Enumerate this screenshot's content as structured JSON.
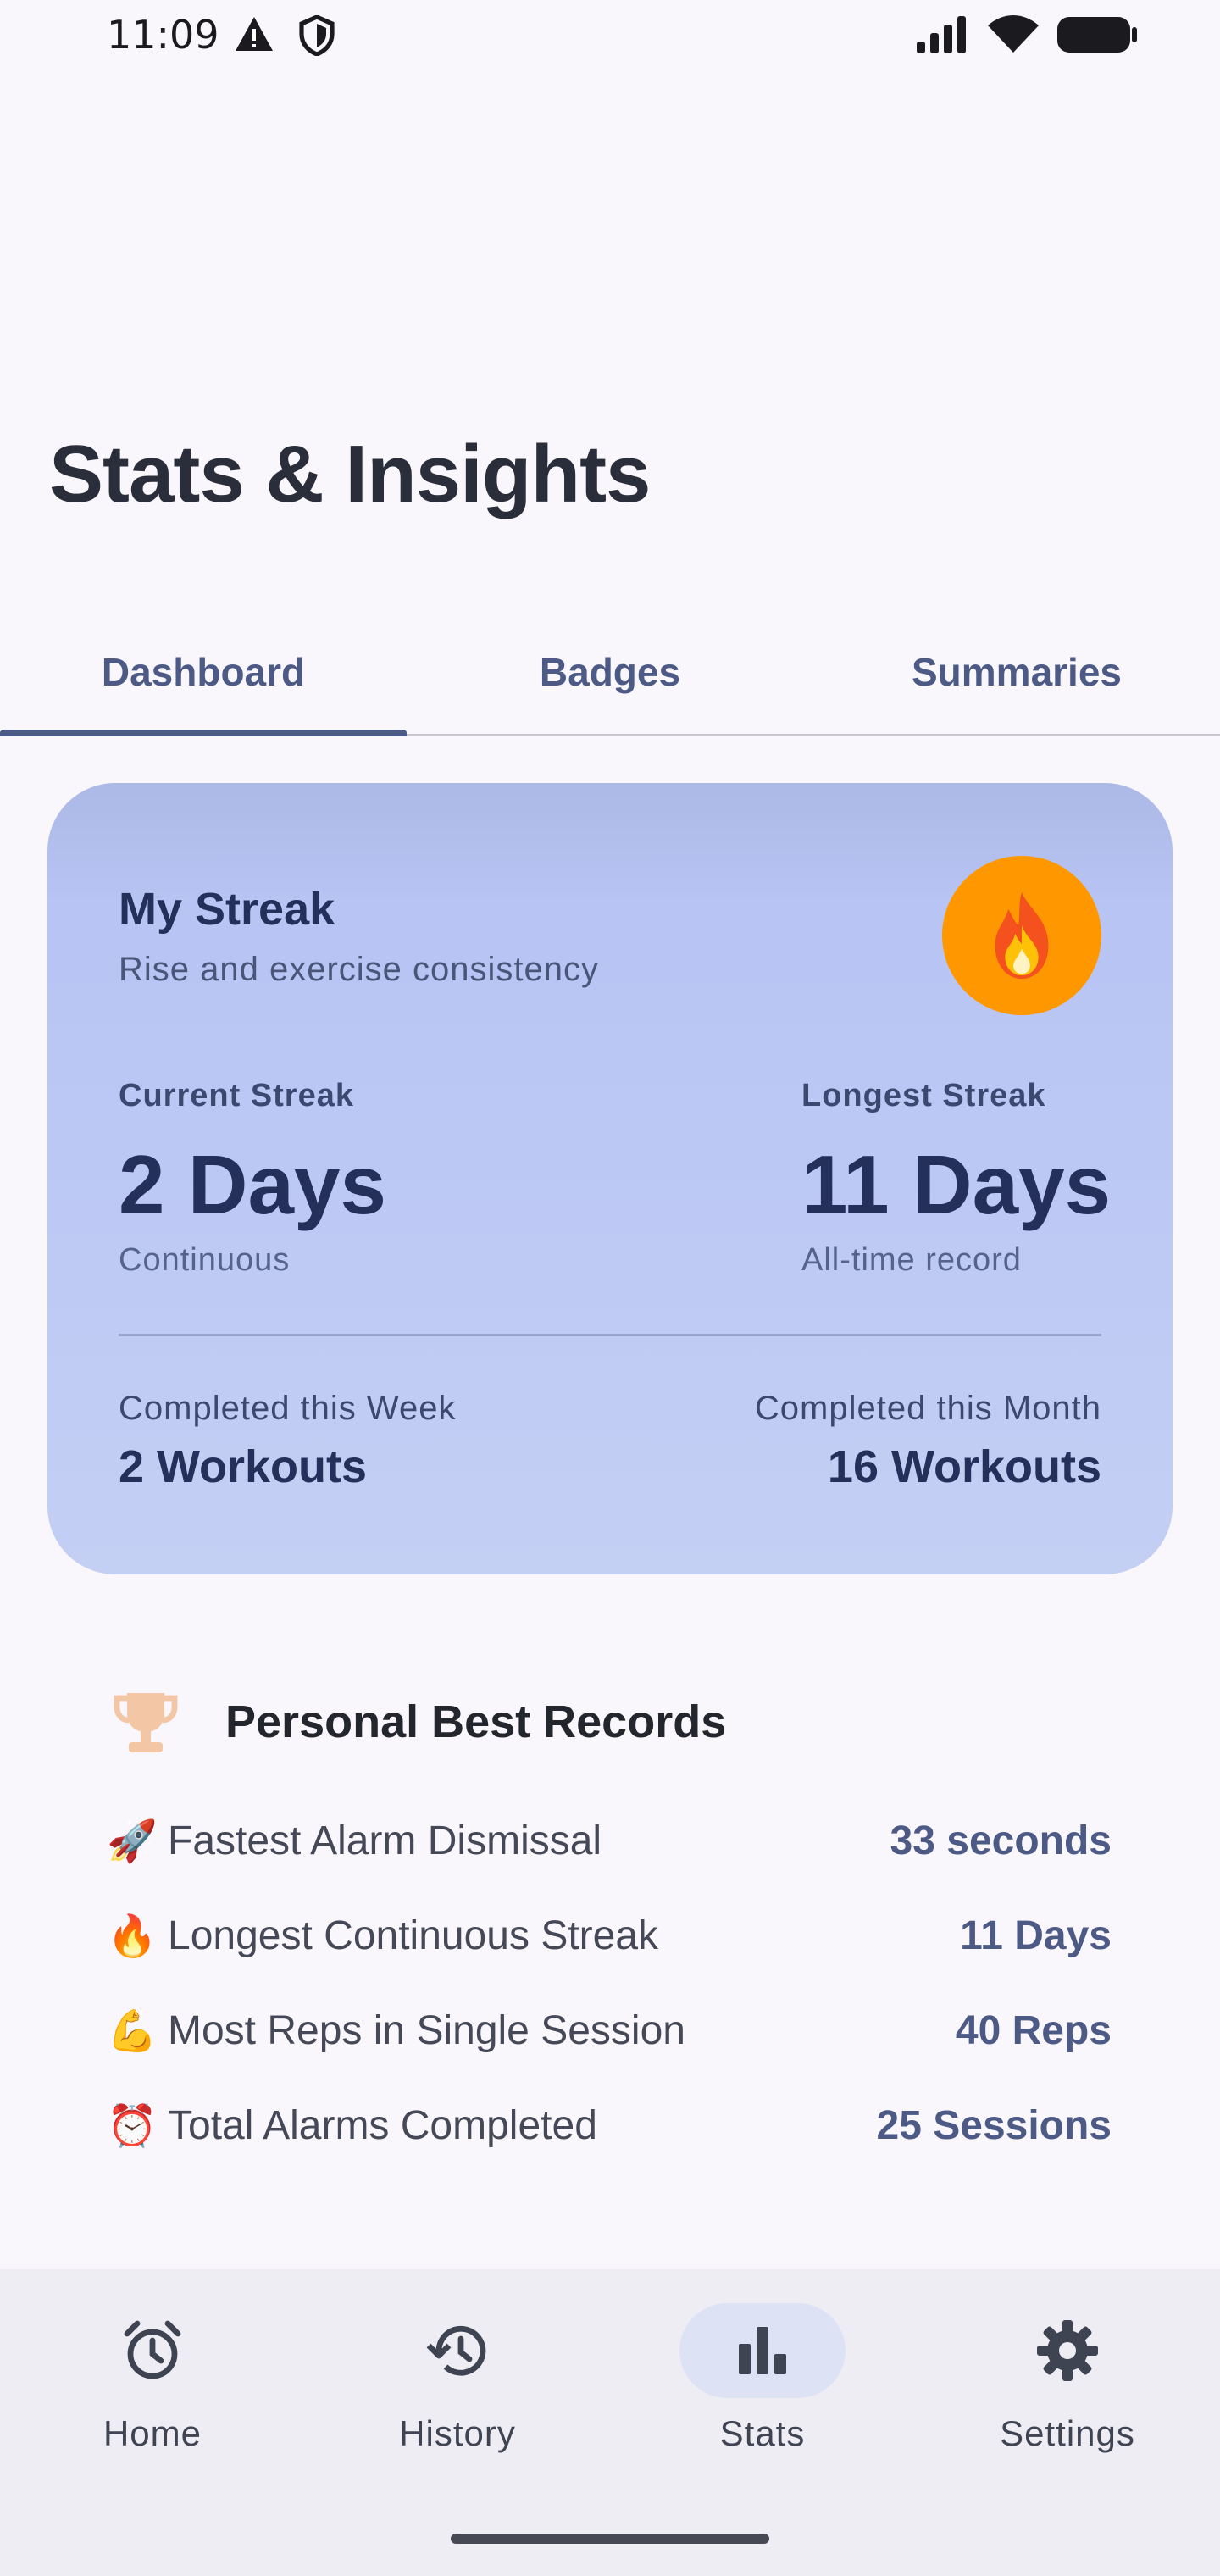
{
  "status_bar": {
    "time": "11:09"
  },
  "page": {
    "title": "Stats & Insights"
  },
  "tabs": [
    {
      "label": "Dashboard"
    },
    {
      "label": "Badges"
    },
    {
      "label": "Summaries"
    }
  ],
  "active_tab_index": 0,
  "streak_card": {
    "title": "My Streak",
    "subtitle": "Rise and exercise consistency",
    "badge_icon": "fire-icon",
    "badge_color": "#FF9800",
    "current": {
      "label": "Current Streak",
      "value": "2 Days",
      "note": "Continuous"
    },
    "longest": {
      "label": "Longest Streak",
      "value": "11 Days",
      "note": "All-time record"
    },
    "week": {
      "label": "Completed this Week",
      "value": "2 Workouts"
    },
    "month": {
      "label": "Completed this Month",
      "value": "16 Workouts"
    }
  },
  "personal_best": {
    "title": "Personal Best Records",
    "icon": "trophy-icon",
    "rows": [
      {
        "emoji": "🚀",
        "label": "Fastest Alarm Dismissal",
        "value": "33 seconds"
      },
      {
        "emoji": "🔥",
        "label": "Longest Continuous Streak",
        "value": "11 Days"
      },
      {
        "emoji": "💪",
        "label": "Most Reps in Single Session",
        "value": "40 Reps"
      },
      {
        "emoji": "⏰",
        "label": "Total Alarms Completed",
        "value": "25 Sessions"
      }
    ]
  },
  "bottom_nav": [
    {
      "label": "Home",
      "icon": "alarm-clock-icon"
    },
    {
      "label": "History",
      "icon": "history-icon"
    },
    {
      "label": "Stats",
      "icon": "bar-chart-icon"
    },
    {
      "label": "Settings",
      "icon": "gear-icon"
    }
  ],
  "active_nav_index": 2,
  "colors": {
    "accent": "#4C5A85",
    "card_bg": "#B7C4F4",
    "nav_active_bg": "#DDE2F5"
  }
}
